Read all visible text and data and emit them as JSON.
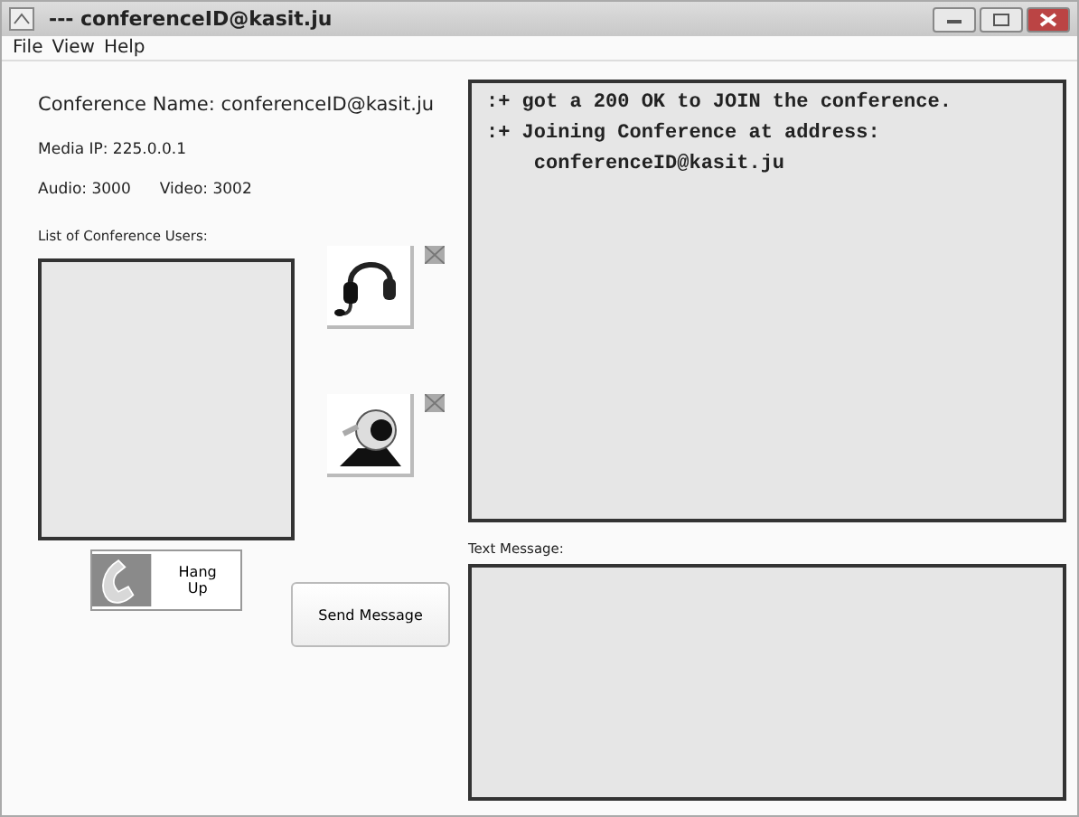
{
  "window": {
    "title": "---  conferenceID@kasit.ju"
  },
  "menu": [
    "File",
    "View",
    "Help"
  ],
  "info": {
    "conference_name": "Conference Name: conferenceID@kasit.ju",
    "media_ip": "Media IP: 225.0.0.1",
    "audio": "Audio: 3000",
    "video": "Video: 3002"
  },
  "users": {
    "label": "List of Conference Users:"
  },
  "log": [
    ":+ got a 200 OK to JOIN the conference.",
    ":+ Joining Conference at address:",
    "    conferenceID@kasit.ju"
  ],
  "text_message": {
    "label": "Text Message:"
  },
  "buttons": {
    "hang_up": "Hang Up",
    "send": "Send Message"
  }
}
